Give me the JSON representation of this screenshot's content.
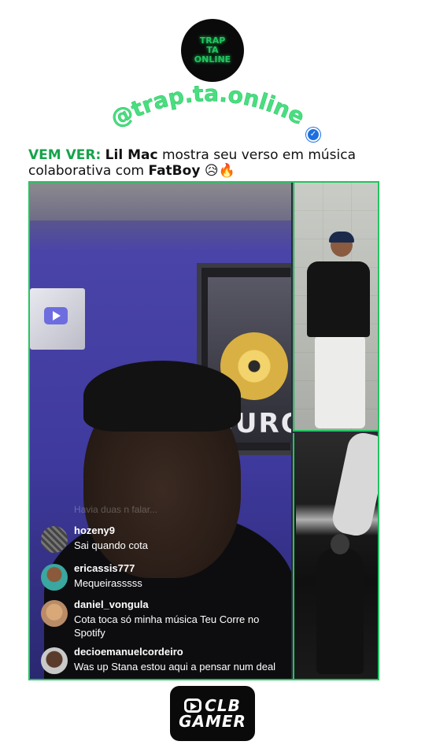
{
  "logo": {
    "line1": "TRAP",
    "line2": "TA",
    "line3": "ONLINE"
  },
  "handle": {
    "text": "@trap.ta.online",
    "verified_icon": "check-icon"
  },
  "headline": {
    "prefix": "VEM VER:",
    "artist": "Lil Mac",
    "middle": " mostra seu verso em música colaborativa com ",
    "feature": "FatBoy",
    "emojis": "😥🔥"
  },
  "video": {
    "wall_text": "OURO",
    "faded_comment": "Havia duas n falar...",
    "comments": [
      {
        "user": "hozeny9",
        "text": "Sai quando cota"
      },
      {
        "user": "ericassis777",
        "text": "Mequeirasssss"
      },
      {
        "user": "daniel_vongula",
        "text": "Cota toca só minha música Teu Corre no Spotify"
      },
      {
        "user": "decioemanuelcordeiro",
        "text": "Was up Stana estou aqui a pensar num deal"
      }
    ]
  },
  "brand": {
    "word1": "CLB",
    "word2": "GAMER"
  },
  "colors": {
    "accent": "#22c55e",
    "verified": "#1d6fe0",
    "text": "#111111"
  }
}
